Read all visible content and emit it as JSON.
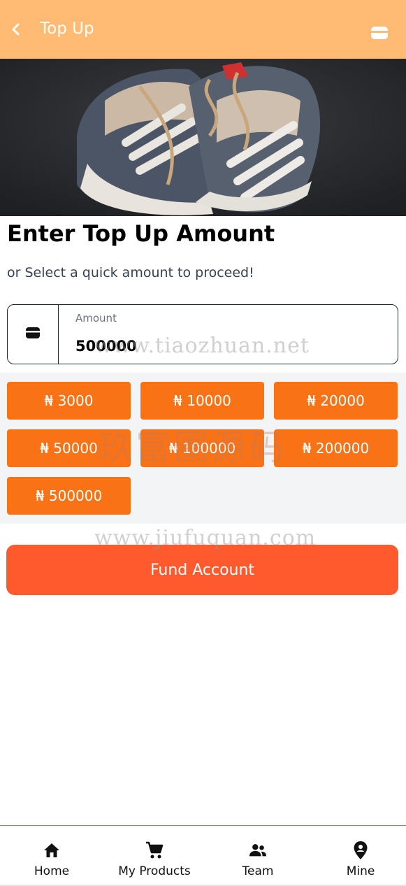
{
  "header": {
    "title": "Top Up",
    "back_icon": "chevron-left-icon",
    "wallet_icon": "wallet-icon",
    "background": "#ffba73"
  },
  "main": {
    "heading": "Enter Top Up Amount",
    "subheading": "or Select a quick amount to proceed!",
    "amount_field": {
      "label": "Amount",
      "value": "500000",
      "icon": "wallet-icon"
    },
    "quick_amounts": [
      "₦ 3000",
      "₦ 10000",
      "₦ 20000",
      "₦ 50000",
      "₦ 100000",
      "₦ 200000",
      "₦ 500000"
    ],
    "fund_button": "Fund Account"
  },
  "watermarks": {
    "top": "www.tiaozhuan.net",
    "middle": "玖富圈源码",
    "bottom": "www.jiufuquan.com"
  },
  "bottom_nav": [
    {
      "label": "Home",
      "icon": "home-icon"
    },
    {
      "label": "My Products",
      "icon": "cart-icon"
    },
    {
      "label": "Team",
      "icon": "team-icon"
    },
    {
      "label": "Mine",
      "icon": "location-pin-icon"
    }
  ],
  "colors": {
    "accent": "#f97316",
    "fund_button": "#ff5a2e",
    "panel": "#f3f4f6"
  }
}
